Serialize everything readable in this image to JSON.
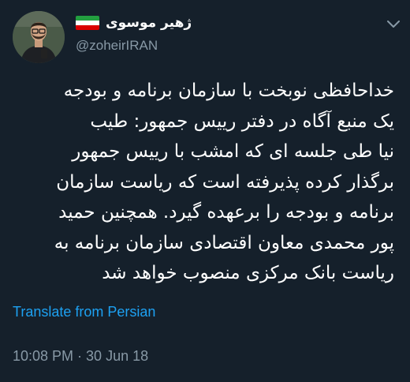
{
  "author": {
    "display_name": "ژهیر موسوی",
    "handle": "@zoheirIRAN",
    "flag_icon": "iran-flag-icon",
    "flag_colors": [
      "#239f40",
      "#ffffff",
      "#da0000"
    ]
  },
  "tweet": {
    "lines": [
      "خداحافظی نوبخت با سازمان برنامه و بودجه",
      "یک منبع آگاه در دفتر رییس جمهور: طیب",
      "نیا طی جلسه ای که امشب با رییس جمهور",
      "برگذار کرده پذیرفته است که ریاست سازمان",
      "برنامه و بودجه را برعهده گیرد. همچنین حمید",
      "پور محمدی معاون اقتصادی سازمان برنامه به",
      "ریاست بانک مرکزی منصوب خواهد شد"
    ],
    "translate_label": "Translate from Persian",
    "timestamp": "10:08 PM · 30 Jun 18"
  },
  "menu": {
    "icon": "chevron-down-icon"
  },
  "colors": {
    "background": "#15202b",
    "text": "#ffffff",
    "secondary_text": "#8899a6",
    "link": "#1da1f2"
  }
}
